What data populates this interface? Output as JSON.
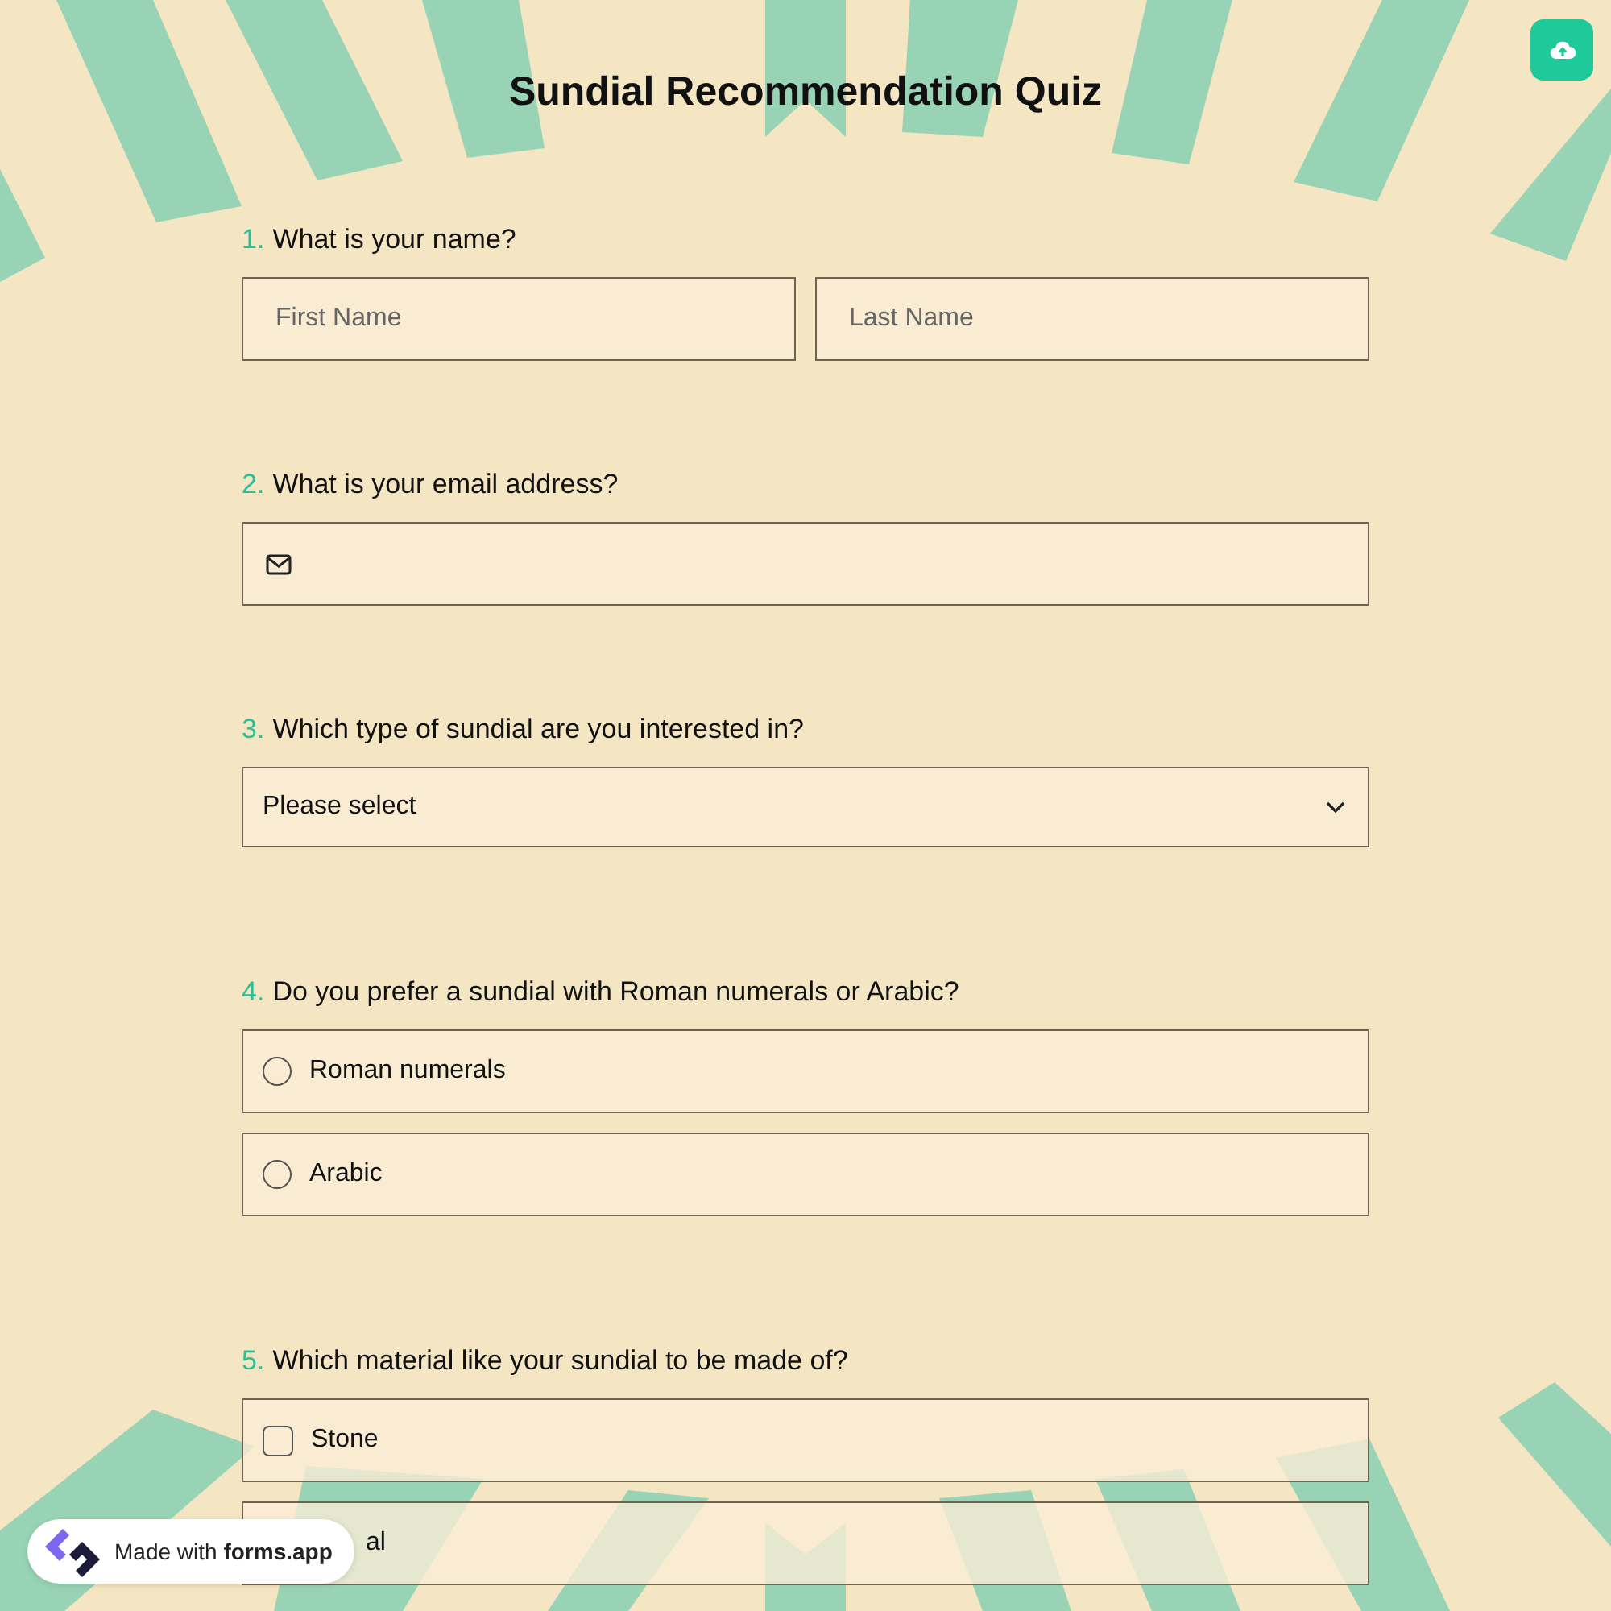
{
  "title": "Sundial Recommendation Quiz",
  "questions": [
    {
      "number": "1.",
      "label": "What is your name?",
      "kind": "name",
      "fields": [
        {
          "placeholder": "First Name"
        },
        {
          "placeholder": "Last Name"
        }
      ]
    },
    {
      "number": "2.",
      "label": "What is your email address?",
      "kind": "email"
    },
    {
      "number": "3.",
      "label": "Which type of sundial are you interested in?",
      "kind": "select",
      "placeholder": "Please select"
    },
    {
      "number": "4.",
      "label": "Do you prefer a sundial with Roman numerals or Arabic?",
      "kind": "radio",
      "options": [
        {
          "label": "Roman numerals",
          "selected": false
        },
        {
          "label": "Arabic",
          "selected": false
        }
      ]
    },
    {
      "number": "5.",
      "label": "Which material like your sundial to be made of?",
      "kind": "checkbox",
      "options": [
        {
          "kind": "box",
          "label": "Stone",
          "checked": false
        },
        {
          "kind": "covered",
          "label": "al"
        }
      ]
    }
  ],
  "badge": {
    "text": "Made with **forms.app**"
  }
}
